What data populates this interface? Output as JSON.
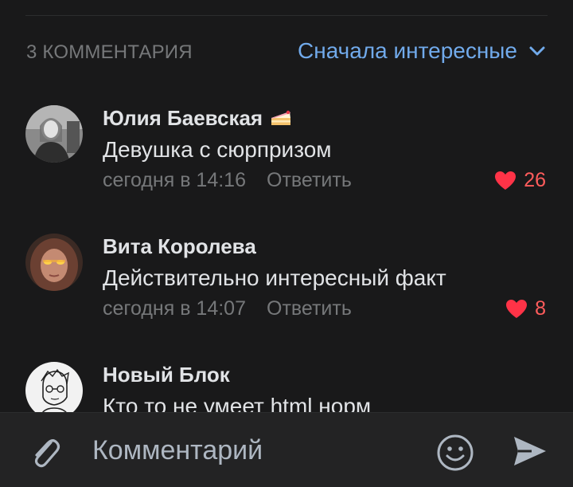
{
  "header": {
    "comments_count_label": "3 КОММЕНТАРИЯ",
    "sort_label": "Сначала интересные"
  },
  "comments": [
    {
      "author": "Юлия Баевская",
      "author_emoji": "cake-emoji",
      "text": "Девушка с сюрпризом",
      "date": "сегодня в 14:16",
      "reply_label": "Ответить",
      "likes": "26"
    },
    {
      "author": "Вита Королева",
      "text": "Действительно интересный факт",
      "date": "сегодня в 14:07",
      "reply_label": "Ответить",
      "likes": "8"
    },
    {
      "author": "Новый Блок",
      "text": "Кто то не умеет html норм"
    }
  ],
  "composer": {
    "placeholder": "Комментарий",
    "icons": [
      "paperclip-icon",
      "smile-icon",
      "send-icon"
    ]
  },
  "colors": {
    "background": "#19191a",
    "accent": "#71aaeb",
    "like": "#ff5c5c",
    "secondary_text": "#76787a"
  }
}
